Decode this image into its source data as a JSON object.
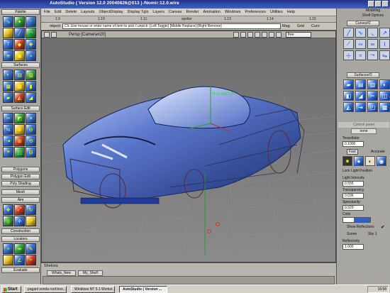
{
  "window": {
    "title": "AutoStudio ( Version 12.0 20040826@013 ) /Nomir:12.0.wire"
  },
  "menubar": [
    "File",
    "Edit",
    "Delete",
    "Layouts",
    "ObjectDisplay",
    "Display Tgls",
    "Layers",
    "Canvas",
    "Render",
    "Animation",
    "Windows",
    "Preferences",
    "Utilities",
    "Help"
  ],
  "ruler": [
    "1.9",
    "1.10",
    "1.11",
    "spoiler",
    "1.13",
    "1.14",
    "1.15"
  ],
  "prompt": {
    "label": "object:",
    "text": "Cli: Use mouse or enter name of item to pick / unpick: [Left Toggle] [Middle Replace] [Right Remove]",
    "right": [
      "Mag",
      "Grid",
      "Curv"
    ]
  },
  "left_palette": {
    "app_label": "Palette",
    "sections": [
      "Surfaces",
      "Surface Edit",
      "Polygons",
      "Polygon Edit",
      "Poly Shading",
      "Mesh",
      "Aim",
      "Construction",
      "Locators",
      "Evaluate"
    ]
  },
  "viewport": {
    "title": "Persp [Camera#20]",
    "mode": "free",
    "axis_label": "TFOI FACTOR"
  },
  "right_palette": {
    "header": [
      "Modeling",
      "Shelf Options"
    ],
    "sections": [
      "Curves#2",
      "Surfaces#2"
    ],
    "control_panel": "Control panel",
    "none_label": "none",
    "fields": [
      {
        "label": "Tessellator",
        "value": "0.1000"
      },
      {
        "label": "Accurate",
        "value": ""
      },
      {
        "label": "Lock Light Position",
        "value": ""
      },
      {
        "label": "Light Intensity",
        "value": "0.555"
      },
      {
        "label": "Transparency",
        "value": "0.036"
      },
      {
        "label": "Specularity",
        "value": "0.929"
      },
      {
        "label": "Color",
        "value": ""
      },
      {
        "label": "Show Reflections",
        "value": ""
      },
      {
        "label": "Scene",
        "value": "Sky 1"
      },
      {
        "label": "Reflectivity",
        "value": "1.000"
      }
    ],
    "fast_label": "Fast"
  },
  "shelves": {
    "title": "Shelves",
    "tabs": [
      "Whats_New",
      "My_Shelf"
    ]
  },
  "taskbar": {
    "start": "Start",
    "buttons": [
      "pagani zonda roof.boo...",
      "Windows NT 5.1 Workst...",
      "AutoStudio ( Version ..."
    ],
    "clock": "18:58"
  }
}
